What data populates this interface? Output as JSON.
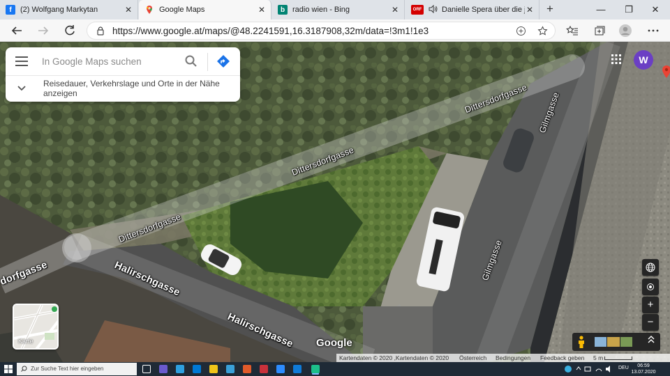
{
  "browser": {
    "tabs": [
      {
        "title": "(2) Wolfgang Markytan",
        "favicon": "facebook-icon",
        "color": "#1877f2"
      },
      {
        "title": "Google Maps",
        "favicon": "google-maps-icon",
        "color": "#34a853"
      },
      {
        "title": "radio wien - Bing",
        "favicon": "bing-icon",
        "color": "#008373"
      },
      {
        "title": "Danielle Spera über die j",
        "favicon": "orf-icon",
        "color": "#d40000"
      }
    ],
    "close_glyph": "✕",
    "new_tab_glyph": "+",
    "window_controls": {
      "minimize": "—",
      "restore": "❐",
      "close": "✕"
    },
    "url": "https://www.google.at/maps/@48.2241591,16.3187908,32m/data=!3m1!1e3"
  },
  "maps": {
    "search_placeholder": "In Google Maps suchen",
    "nearby_text": "Reisedauer, Verkehrslage und Orte in der Nähe anzeigen",
    "account_initial": "W",
    "layers_label": "Karte",
    "logo": "Google",
    "streets": [
      {
        "name": "Dittersdorfgasse"
      },
      {
        "name": "Dittersdorfgasse"
      },
      {
        "name": "Dittersdorfgasse"
      },
      {
        "name": "Gilmgasse"
      },
      {
        "name": "Gilmgasse"
      },
      {
        "name": "Halirschgasse"
      },
      {
        "name": "Halirschgasse"
      },
      {
        "name": "dorfgasse"
      }
    ],
    "controls": {
      "zoom_in": "+",
      "zoom_out": "−"
    },
    "attribution": {
      "data": "Kartendaten © 2020 ,Kartendaten © 2020",
      "country": "Österreich",
      "terms": "Bedingungen",
      "feedback": "Feedback geben",
      "scale": "5 m"
    }
  },
  "taskbar": {
    "search_placeholder": "Zur Suche Text hier eingeben",
    "language": "DEU",
    "time": "06:59",
    "date": "13.07.2020"
  }
}
